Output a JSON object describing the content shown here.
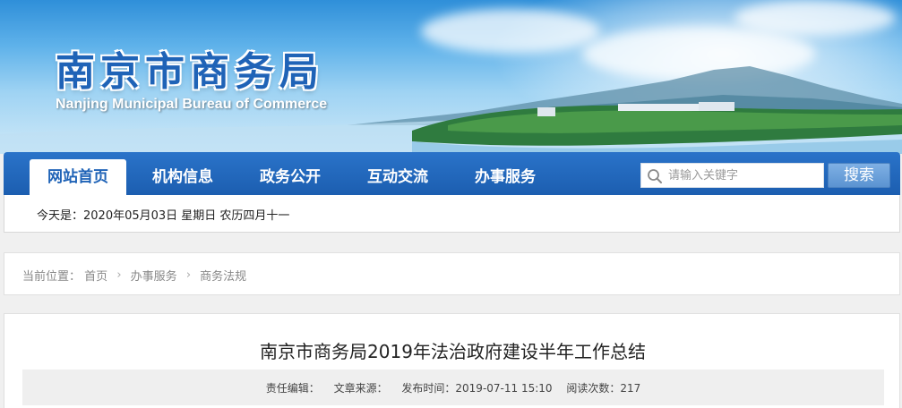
{
  "banner": {
    "title_cn": "南京市商务局",
    "title_en": "Nanjing Municipal Bureau of Commerce"
  },
  "nav": {
    "items": [
      {
        "label": "网站首页",
        "active": true
      },
      {
        "label": "机构信息",
        "active": false
      },
      {
        "label": "政务公开",
        "active": false
      },
      {
        "label": "互动交流",
        "active": false
      },
      {
        "label": "办事服务",
        "active": false
      }
    ],
    "search_placeholder": "请输入关键字",
    "search_button": "搜索"
  },
  "datebar": {
    "text": "今天是：2020年05月03日  星期日   农历四月十一"
  },
  "breadcrumb": {
    "prefix": "当前位置：",
    "items": [
      "首页",
      "办事服务",
      "商务法规"
    ]
  },
  "article": {
    "title": "南京市商务局2019年法治政府建设半年工作总结",
    "meta": {
      "editor": "责任编辑：",
      "source": "文章来源：",
      "published": "发布时间：2019-07-11 15:10",
      "views": "阅读次数：217"
    }
  },
  "colors": {
    "nav_blue": "#1f63b7",
    "search_button": "#5b93d1"
  }
}
